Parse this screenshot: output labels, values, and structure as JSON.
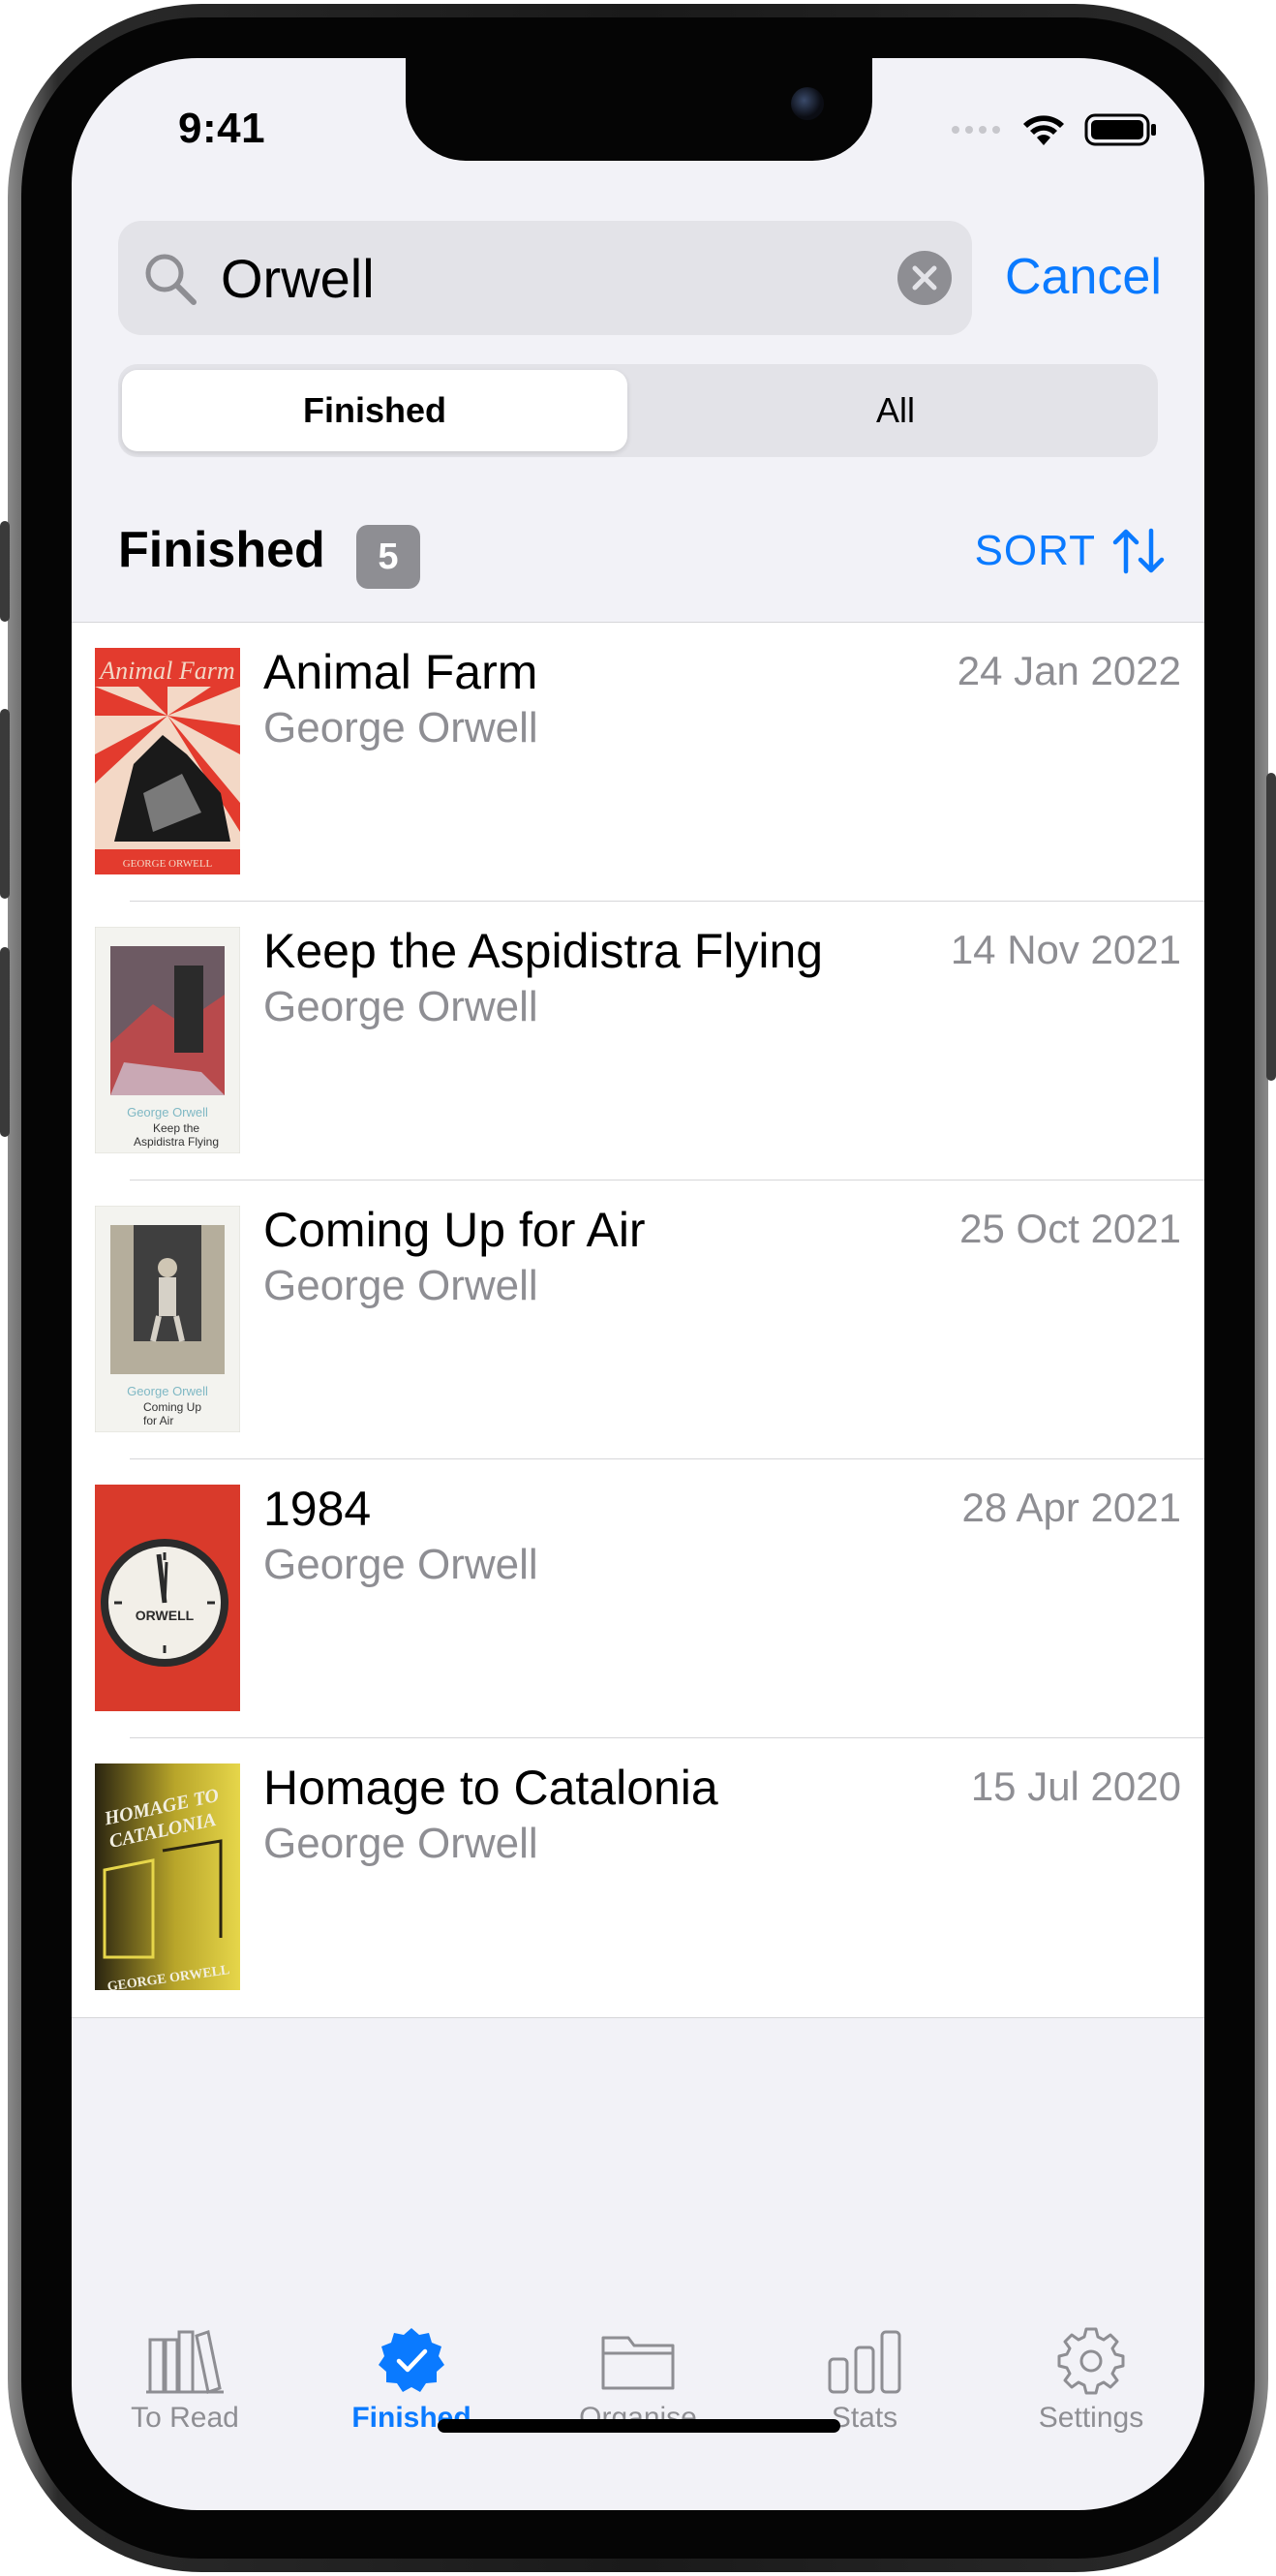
{
  "status_bar": {
    "time": "9:41"
  },
  "search": {
    "value": "Orwell",
    "cancel_label": "Cancel"
  },
  "segments": {
    "selected": "Finished",
    "other": "All"
  },
  "section": {
    "title": "Finished",
    "count": "5",
    "sort_label": "SORT"
  },
  "books": [
    {
      "title": "Animal Farm",
      "author": "George Orwell",
      "date": "24 Jan 2022",
      "cover_text": "Animal Farm",
      "cover_author": "GEORGE ORWELL"
    },
    {
      "title": "Keep the Aspidistra Flying",
      "author": "George Orwell",
      "date": "14 Nov 2021",
      "cover_text": "Keep the Aspidistra Flying",
      "cover_author": "George Orwell"
    },
    {
      "title": "Coming Up for Air",
      "author": "George Orwell",
      "date": "25 Oct 2021",
      "cover_text": "Coming Up for Air",
      "cover_author": "George Orwell"
    },
    {
      "title": "1984",
      "author": "George Orwell",
      "date": "28 Apr 2021",
      "cover_text": "ORWELL",
      "cover_author": ""
    },
    {
      "title": "Homage to Catalonia",
      "author": "George Orwell",
      "date": "15 Jul 2020",
      "cover_text": "HOMAGE TO CATALONIA",
      "cover_author": "GEORGE ORWELL"
    }
  ],
  "tabs": [
    {
      "label": "To Read",
      "icon": "books-icon"
    },
    {
      "label": "Finished",
      "icon": "checkmark-seal-icon"
    },
    {
      "label": "Organise",
      "icon": "folder-icon"
    },
    {
      "label": "Stats",
      "icon": "bar-chart-icon"
    },
    {
      "label": "Settings",
      "icon": "gear-icon"
    }
  ],
  "colors": {
    "accent": "#0a7aff",
    "secondary_text": "#8e8e93",
    "background": "#f2f2f7"
  }
}
